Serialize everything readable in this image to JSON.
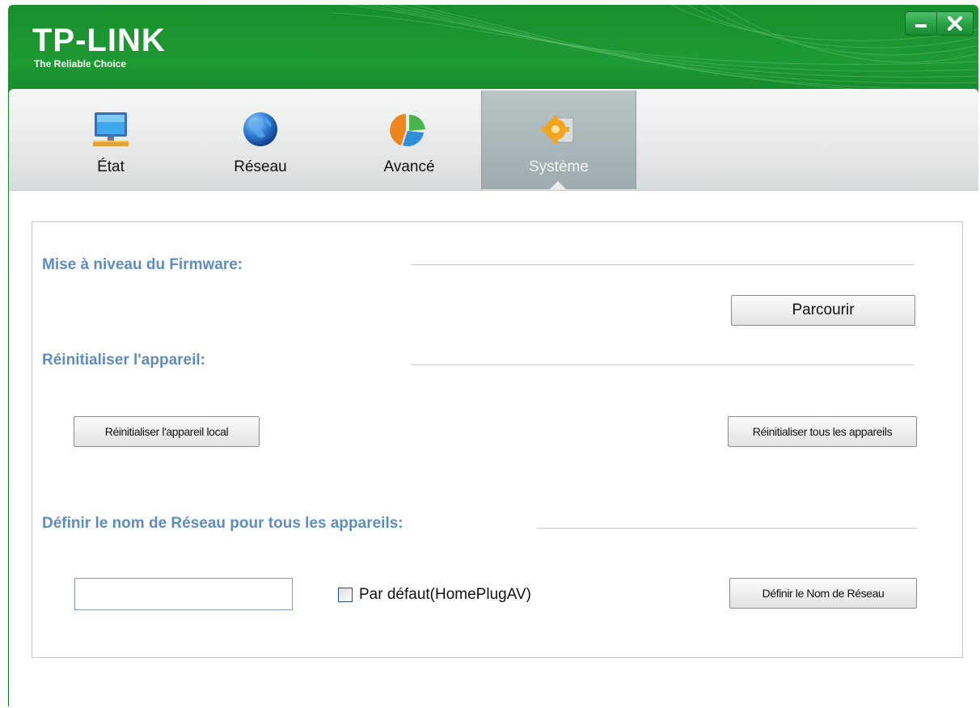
{
  "app": {
    "logo": "TP-LINK",
    "tagline": "The Reliable Choice"
  },
  "window_controls": {
    "minimize_icon": "minimize-icon",
    "close_icon": "close-icon"
  },
  "tabs": [
    {
      "label": "État",
      "icon": "monitor-icon",
      "active": false
    },
    {
      "label": "Réseau",
      "icon": "globe-icon",
      "active": false
    },
    {
      "label": "Avancé",
      "icon": "pie-chart-icon",
      "active": false
    },
    {
      "label": "Système",
      "icon": "gear-icon",
      "active": true
    }
  ],
  "firmware": {
    "title": "Mise à niveau du Firmware:",
    "browse_label": "Parcourir"
  },
  "reset": {
    "title": "Réinitialiser l'appareil:",
    "local_label": "Réinitialiser l'appareil local",
    "all_label": "Réinitialiser tous les appareils"
  },
  "network_name": {
    "title": "Définir le nom de Réseau pour tous les appareils:",
    "input_value": "",
    "checkbox_label": "Par défaut(HomePlugAV)",
    "checkbox_checked": false,
    "set_label": "Définir le Nom de Réseau"
  },
  "colors": {
    "brand_green": "#14892a",
    "section_title": "#5f8cc0",
    "active_tab": "#a8b5b8"
  }
}
